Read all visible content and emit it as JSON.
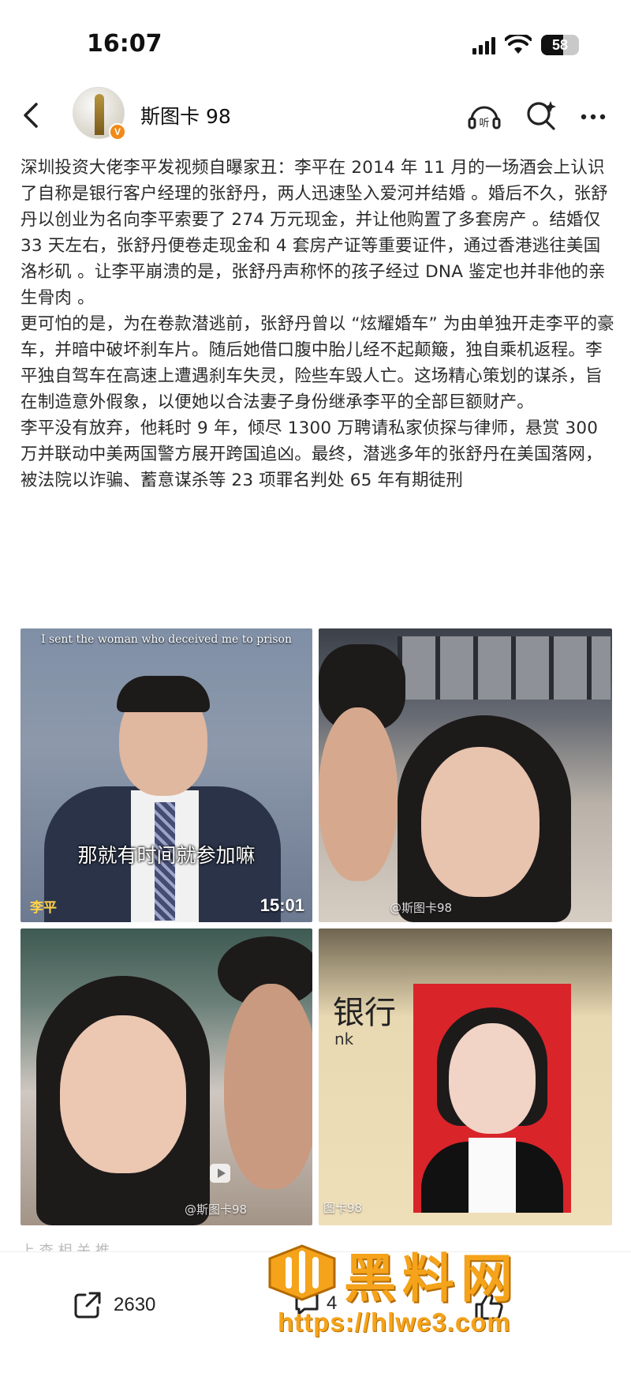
{
  "status_bar": {
    "time": "16:07",
    "battery": "58",
    "battery_level": 0.58
  },
  "header": {
    "username": "斯图卡 98",
    "verified_badge": "V",
    "icons": [
      "back-icon",
      "listen-icon",
      "search-icon",
      "more-icon"
    ],
    "listen_label": "听"
  },
  "article": {
    "paragraphs": [
      "深圳投资大佬李平发视频自曝家丑：李平在 2014 年 11 月的一场酒会上认识了自称是银行客户经理的张舒丹，两人迅速坠入爱河并结婚 。婚后不久，张舒丹以创业为名向李平索要了 274 万元现金，并让他购置了多套房产 。结婚仅 33 天左右，张舒丹便卷走现金和 4 套房产证等重要证件，通过香港逃往美国洛杉矶 。让李平崩溃的是，张舒丹声称怀的孩子经过 DNA 鉴定也并非他的亲生骨肉 。",
      "更可怕的是，为在卷款潜逃前，张舒丹曾以 “炫耀婚车” 为由单独开走李平的豪车，并暗中破坏刹车片。随后她借口腹中胎儿经不起颠簸，独自乘机返程。李平独自驾车在高速上遭遇刹车失灵，险些车毁人亡。这场精心策划的谋杀，旨在制造意外假象，以便她以合法妻子身份继承李平的全部巨额财产。",
      "李平没有放弃，他耗时 9 年，倾尽 1300 万聘请私家侦探与律师，悬赏 300 万并联动中美两国警方展开跨国追凶。最终，潜逃多年的张舒丹在美国落网，被法院以诈骗、蓄意谋杀等 23 项罪名判处 65 年有期徒刑"
    ]
  },
  "images": {
    "tile1": {
      "caption_en": "I sent the woman who deceived me to prison",
      "subtitle": "那就有时间就参加嘛",
      "name_tag": "李平",
      "duration": "15:01"
    },
    "tile2": {
      "watermark": "@斯图卡98"
    },
    "tile3": {
      "watermark": "@斯图卡98"
    },
    "tile4": {
      "bank_text": "银行",
      "bank_sub": "nk",
      "watermark": "图卡98"
    }
  },
  "footer": {
    "more_link": "上 查 相 关 推",
    "share_count": "2630",
    "comment_count": "4"
  },
  "watermark": {
    "site_name": "黑料网",
    "url": "https://hlwe3.com"
  },
  "colors": {
    "accent_orange": "#f5a31a",
    "badge_orange": "#f08a18",
    "text": "#2b2b2b"
  }
}
